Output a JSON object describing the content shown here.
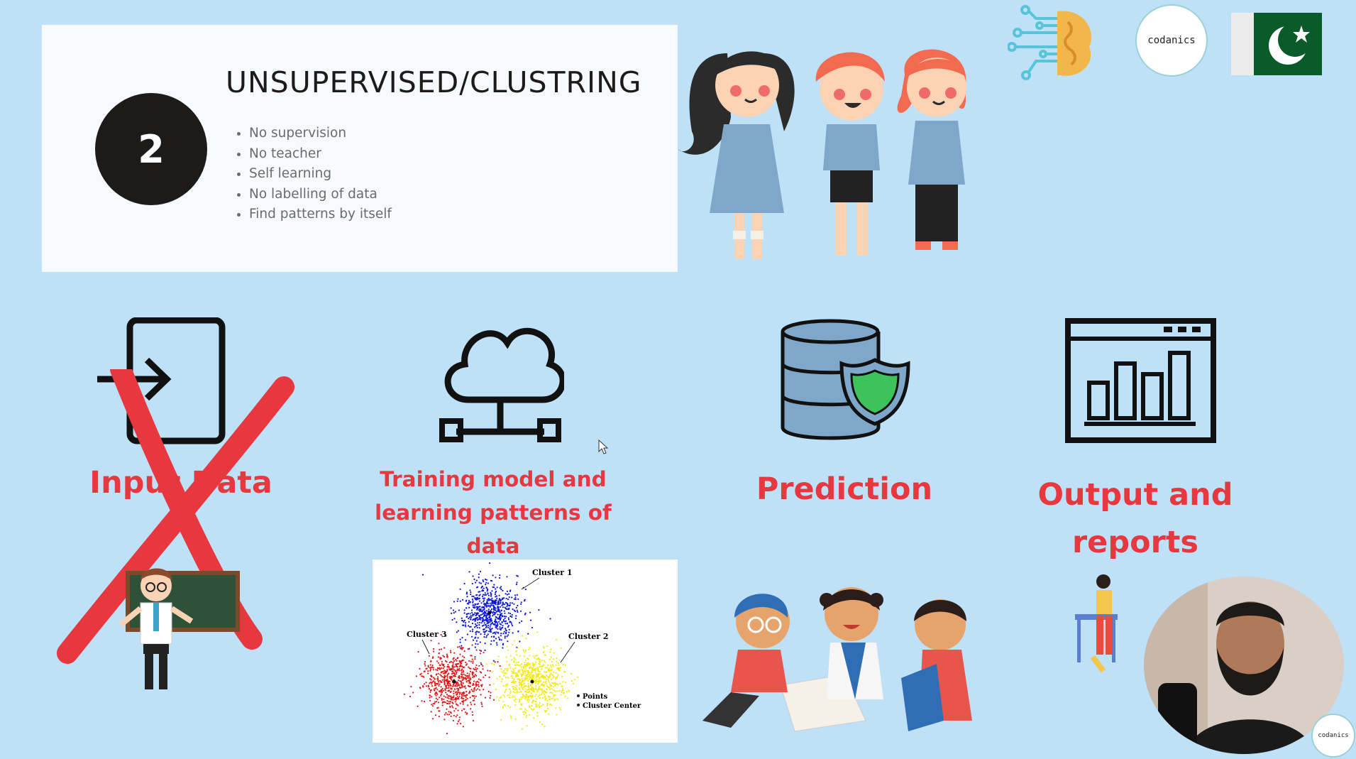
{
  "slide": {
    "number": "2",
    "title": "UNSUPERVISED/CLUSTRING",
    "bullets": [
      "No supervision",
      "No teacher",
      "Self learning",
      "No labelling of data",
      "Find patterns by itself"
    ]
  },
  "steps": [
    {
      "label": "Input Data",
      "icon": "input-file-icon",
      "crossed_out": true
    },
    {
      "label": "Training model and learning patterns of data",
      "icon": "cloud-network-icon"
    },
    {
      "label": "Prediction",
      "icon": "database-shield-icon"
    },
    {
      "label": "Output and reports",
      "icon": "bar-chart-browser-icon"
    }
  ],
  "scatter": {
    "cluster1": "Cluster 1",
    "cluster2": "Cluster 2",
    "cluster3": "Cluster 3",
    "legend_points": "Points",
    "legend_center": "Cluster Center"
  },
  "branding": {
    "logo_text": "codanics",
    "flag": "pakistan-flag-icon"
  },
  "colors": {
    "background": "#bfe1f7",
    "accent_red": "#e8383f",
    "cluster_blue": "#0b17d9",
    "cluster_red": "#e11616",
    "cluster_yellow": "#f2ea12"
  }
}
